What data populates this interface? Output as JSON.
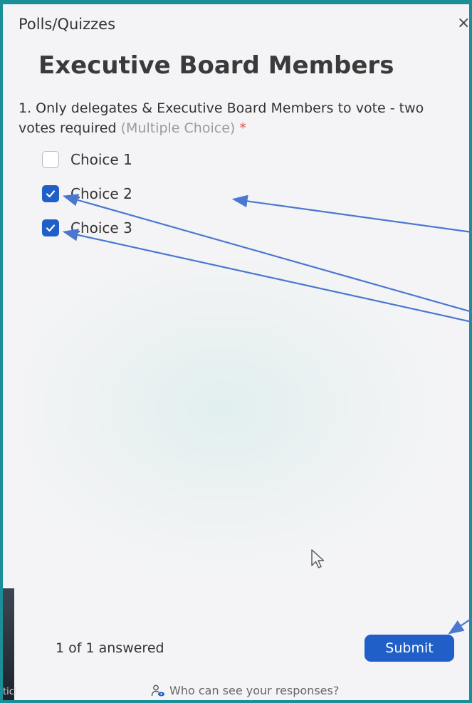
{
  "panel": {
    "header_title": "Polls/Quizzes",
    "close_glyph": "×",
    "poll_title": "Executive Board Members",
    "question": {
      "line1": "1. Only delegates & Executive Board Members to vote - two",
      "line2": "votes required",
      "type_label": "(Multiple Choice)",
      "required_marker": "*"
    },
    "choices": [
      {
        "label": "Choice 1",
        "checked": false
      },
      {
        "label": "Choice 2",
        "checked": true
      },
      {
        "label": "Choice 3",
        "checked": true
      }
    ],
    "answered_status": "1 of 1 answered",
    "submit_label": "Submit",
    "privacy_link": "Who can see your responses?",
    "left_edge_text": "tici"
  },
  "colors": {
    "frame_border": "#1a8f98",
    "accent": "#1f5fc7",
    "annotation_arrow": "#4a78d0",
    "required": "#d9534f"
  },
  "icons": [
    "close-icon",
    "checkmark-icon",
    "person-eye-icon",
    "mouse-cursor-icon",
    "annotation-arrow"
  ]
}
